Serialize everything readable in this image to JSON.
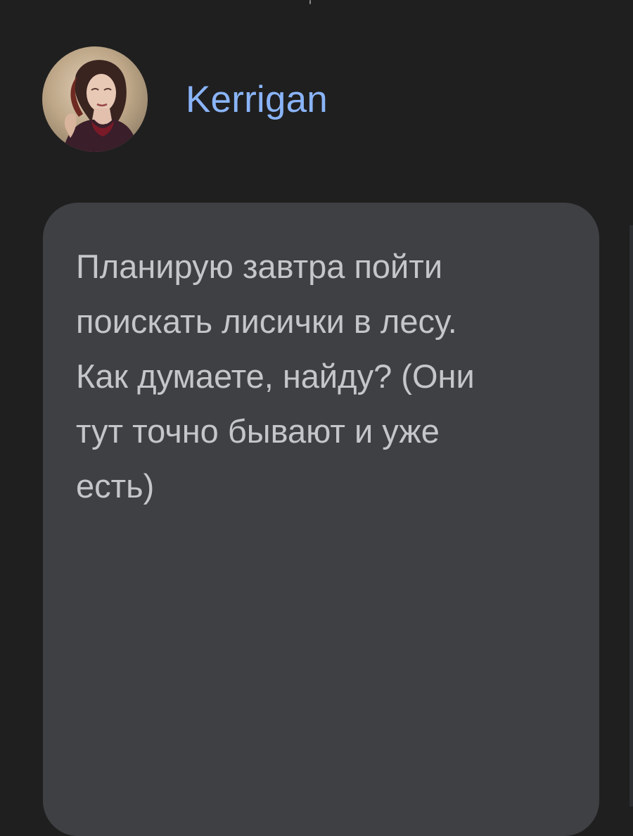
{
  "post": {
    "author": {
      "name": "Kerrigan",
      "avatar_icon": "user-avatar-photo"
    },
    "message": {
      "lines": [
        "Планирую завтра пойти",
        "поискать лисички в лесу.",
        "Как думаете, найду? (Они",
        "тут точно бывают и уже",
        "есть)"
      ]
    }
  },
  "colors": {
    "background": "#1f1f1f",
    "card": "#3f4044",
    "author_name": "#8ab4f8",
    "message_text": "#c4c6c9"
  }
}
